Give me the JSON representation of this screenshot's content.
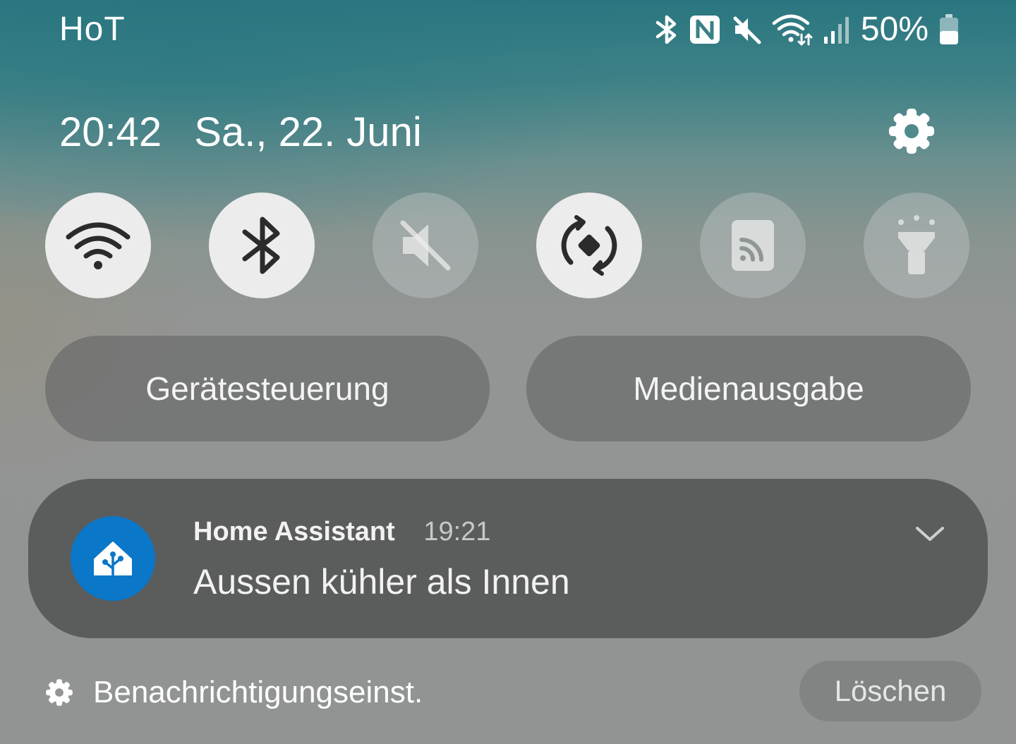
{
  "status_bar": {
    "carrier": "HoT",
    "icons": [
      "bluetooth-icon",
      "nfc-icon",
      "mute-icon",
      "wifi-icon",
      "signal-icon",
      "battery-icon"
    ],
    "battery_percent": "50%",
    "battery_level": 0.5
  },
  "header": {
    "time": "20:42",
    "date": "Sa., 22. Juni",
    "settings_icon": "gear-icon"
  },
  "quick_tiles": [
    {
      "name": "wifi",
      "icon": "wifi-icon",
      "active": true
    },
    {
      "name": "bluetooth",
      "icon": "bluetooth-icon",
      "active": true
    },
    {
      "name": "sound",
      "icon": "mute-icon",
      "active": false
    },
    {
      "name": "auto-rotate",
      "icon": "rotate-icon",
      "active": true
    },
    {
      "name": "cast",
      "icon": "cast-icon",
      "active": false
    },
    {
      "name": "flashlight",
      "icon": "flashlight-icon",
      "active": false
    }
  ],
  "buttons": {
    "device_control": "Gerätesteuerung",
    "media_output": "Medienausgabe"
  },
  "notification": {
    "app_name": "Home Assistant",
    "time": "19:21",
    "text": "Aussen kühler als Innen",
    "app_icon": "home-assistant-icon",
    "accent_color": "#0a77c9"
  },
  "footer": {
    "settings_label": "Benachrichtigungseinst.",
    "clear_label": "Löschen"
  },
  "colors": {
    "tile_active": "#ececec",
    "icon_dark": "#2b2b2b",
    "notification_bg": "#5b5c5c"
  }
}
